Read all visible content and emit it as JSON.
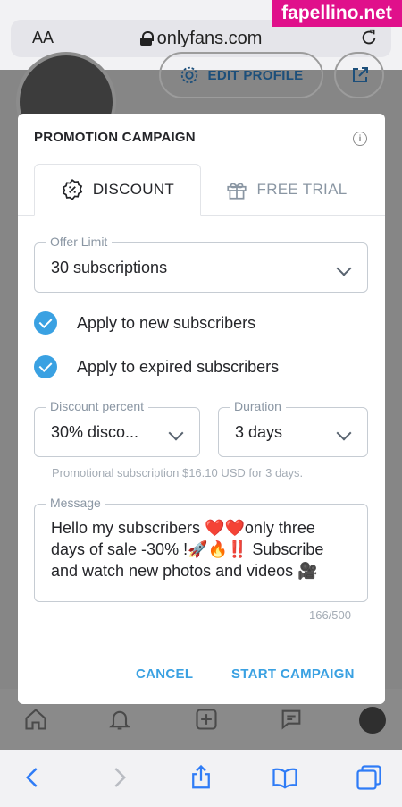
{
  "browser": {
    "text_size_label": "AA",
    "url": "onlyfans.com"
  },
  "watermark": "fapellino.net",
  "background": {
    "edit_profile_label": "EDIT PROFILE"
  },
  "modal": {
    "title": "PROMOTION CAMPAIGN",
    "tabs": [
      {
        "label": "DISCOUNT",
        "icon": "discount-badge-icon",
        "active": true
      },
      {
        "label": "FREE TRIAL",
        "icon": "gift-icon",
        "active": false
      }
    ],
    "offer_limit": {
      "legend": "Offer Limit",
      "value": "30 subscriptions"
    },
    "checkboxes": [
      {
        "label": "Apply to new subscribers",
        "checked": true
      },
      {
        "label": "Apply to expired subscribers",
        "checked": true
      }
    ],
    "discount_percent": {
      "legend": "Discount percent",
      "value": "30% disco..."
    },
    "duration": {
      "legend": "Duration",
      "value": "3 days"
    },
    "hint": "Promotional subscription $16.10 USD for 3 days.",
    "message": {
      "legend": "Message",
      "value": "Hello my subscribers ❤️❤️only three days of sale -30% !🚀🔥‼️ Subscribe and watch new photos and videos 🎥",
      "counter": "166/500"
    },
    "cancel_label": "CANCEL",
    "start_label": "START CAMPAIGN"
  },
  "colors": {
    "accent": "#3aa1e2",
    "text": "#242529",
    "muted": "#8a96a3",
    "online": "#1c9139"
  }
}
